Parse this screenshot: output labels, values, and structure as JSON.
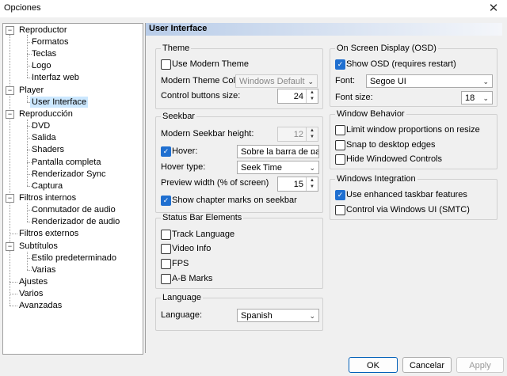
{
  "window": {
    "title": "Opciones",
    "close_glyph": "✕"
  },
  "tree": {
    "reproductor": "Reproductor",
    "reproductor_children": [
      "Formatos",
      "Teclas",
      "Logo",
      "Interfaz web"
    ],
    "player": "Player",
    "player_children": [
      "User Interface"
    ],
    "reproduccion": "Reproducción",
    "reproduccion_children": [
      "DVD",
      "Salida",
      "Shaders",
      "Pantalla completa",
      "Renderizador Sync",
      "Captura"
    ],
    "filtros_internos": "Filtros internos",
    "filtros_internos_children": [
      "Conmutador de audio",
      "Renderizador de audio"
    ],
    "filtros_externos": "Filtros externos",
    "subtitulos": "Subtítulos",
    "subtitulos_children": [
      "Estilo predeterminado",
      "Varias"
    ],
    "ajustes": "Ajustes",
    "varios": "Varios",
    "avanzadas": "Avanzadas",
    "expanded_glyph": "−"
  },
  "header": {
    "title": "User Interface"
  },
  "theme": {
    "title": "Theme",
    "use_modern": "Use Modern Theme",
    "color_label": "Modern Theme Color:",
    "color_value": "Windows Default",
    "size_label": "Control buttons size:",
    "size_value": "24"
  },
  "seekbar": {
    "title": "Seekbar",
    "height_label": "Modern Seekbar height:",
    "height_value": "12",
    "hover_label": "Hover:",
    "hover_value": "Sobre la barra de nav",
    "hover_type_label": "Hover type:",
    "hover_type_value": "Seek Time",
    "preview_label": "Preview width (% of screen)",
    "preview_value": "15",
    "chapter_marks": "Show chapter marks on seekbar"
  },
  "statusbar": {
    "title": "Status Bar Elements",
    "items": [
      "Track Language",
      "Video Info",
      "FPS",
      "A-B Marks"
    ]
  },
  "language": {
    "title": "Language",
    "label": "Language:",
    "value": "Spanish"
  },
  "osd": {
    "title": "On Screen Display (OSD)",
    "show": "Show OSD (requires restart)",
    "font_label": "Font:",
    "font_value": "Segoe UI",
    "size_label": "Font size:",
    "size_value": "18"
  },
  "window_behavior": {
    "title": "Window Behavior",
    "items": [
      "Limit window proportions on resize",
      "Snap to desktop edges",
      "Hide Windowed Controls"
    ]
  },
  "integration": {
    "title": "Windows Integration",
    "taskbar": "Use enhanced taskbar features",
    "smtc": "Control via Windows UI (SMTC)"
  },
  "buttons": {
    "ok": "OK",
    "cancel": "Cancelar",
    "apply": "Apply"
  },
  "glyphs": {
    "check": "✓",
    "down": "⌄",
    "up_arrow": "▲",
    "down_arrow": "▼"
  }
}
